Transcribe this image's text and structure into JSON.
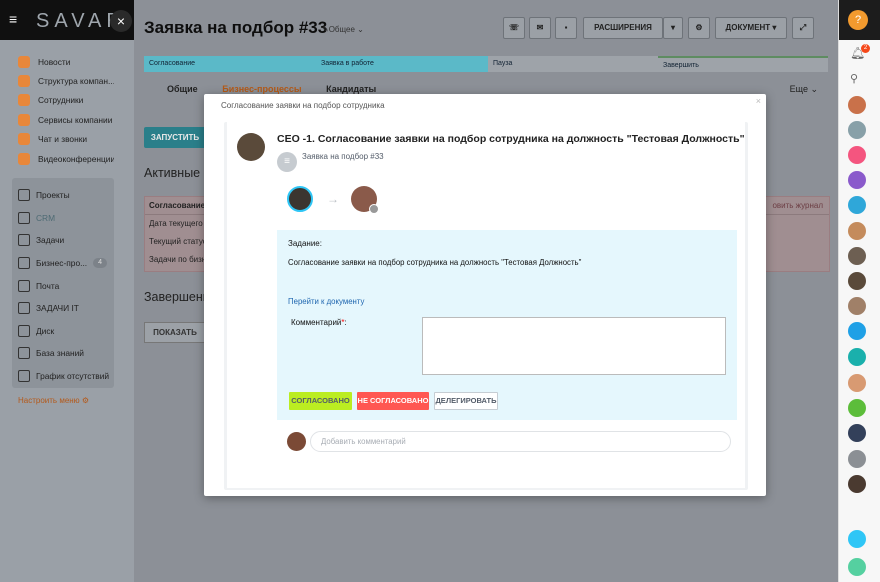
{
  "app": {
    "logo": "SAVAR"
  },
  "left_menu": {
    "group1": [
      "Новости",
      "Структура компан...",
      "Сотрудники",
      "Сервисы компании",
      "Чат и звонки",
      "Видеоконференции"
    ],
    "group2": [
      "Проекты",
      "CRM",
      "Задачи",
      "Бизнес-про...",
      "Почта",
      "ЗАДАЧИ IT",
      "Диск",
      "База знаний",
      "График отсутствий"
    ],
    "bp_badge": "4",
    "configure": "Настроить меню"
  },
  "header": {
    "title": "Заявка на подбор #33",
    "category": "Общее",
    "extensions": "РАСШИРЕНИЯ",
    "document": "ДОКУМЕНТ"
  },
  "stages": [
    "Согласование",
    "Заявка в работе",
    "Пауза",
    "Завершить"
  ],
  "tabs": [
    "Общие",
    "Бизнес-процессы",
    "Кандидаты"
  ],
  "more": "Еще",
  "background": {
    "run": "ЗАПУСТИТЬ",
    "active": "Активные б",
    "table_head": "Согласование",
    "table_head_right": "овить журнал",
    "rows": [
      "Дата текущего",
      "Текущий статус",
      "Задачи по бизн"
    ],
    "completed": "Завершенн",
    "show": "ПОКАЗАТЬ"
  },
  "right_sidebar": {
    "notif_badge": "2"
  },
  "modal": {
    "title": "Согласование заявки на подбор сотрудника",
    "heading": "CEO -1. Согласование заявки на подбор сотрудника на должность \"Тестовая Должность\"",
    "doc_link": "Заявка на подбор #33",
    "task_label": "Задание:",
    "task_desc": "Согласование заявки на подбор сотрудника на должность \"Тестовая Должность\"",
    "goto_doc": "Перейти к документу",
    "comment_label": "Комментарий",
    "required_mark": "*",
    "comment_colon": ":",
    "approve": "СОГЛАСОВАНО",
    "reject": "НЕ СОГЛАСОВАНО",
    "delegate": "ДЕЛЕГИРОВАТЬ",
    "add_comment_placeholder": "Добавить комментарий"
  },
  "colors": {
    "approve": "#bbed21",
    "reject": "#ff5752",
    "task_bg": "#e5f7fd",
    "stage": "#2fc6f6"
  }
}
